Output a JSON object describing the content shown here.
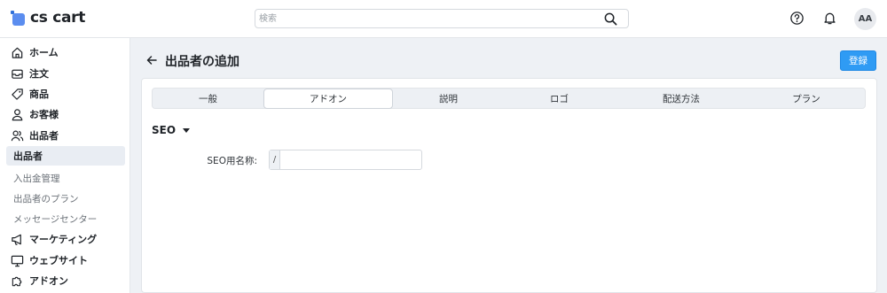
{
  "app": {
    "logo_text": "cs cart",
    "brand_color": "#5b8def"
  },
  "header": {
    "search_placeholder": "検索",
    "search_value": "",
    "avatar_initials": "AA",
    "icons": [
      "search-icon",
      "help-icon",
      "bell-icon"
    ]
  },
  "sidebar": {
    "items": [
      {
        "label": "ホーム",
        "icon": "home-icon"
      },
      {
        "label": "注文",
        "icon": "inbox-icon"
      },
      {
        "label": "商品",
        "icon": "tag-icon"
      },
      {
        "label": "お客様",
        "icon": "user-icon"
      },
      {
        "label": "出品者",
        "icon": "users-icon"
      }
    ],
    "active_label": "出品者",
    "sub_items": [
      "入出金管理",
      "出品者のプラン",
      "メッセージセンター"
    ],
    "bottom_items": [
      {
        "label": "マーケティング",
        "icon": "megaphone-icon"
      },
      {
        "label": "ウェブサイト",
        "icon": "monitor-icon"
      },
      {
        "label": "アドオン",
        "icon": "puzzle-icon"
      }
    ]
  },
  "page": {
    "title": "出品者の追加",
    "register_button": "登録",
    "accent_color": "#2f9bf4"
  },
  "tabs": [
    {
      "label": "一般",
      "active": false
    },
    {
      "label": "アドオン",
      "active": true
    },
    {
      "label": "説明",
      "active": false
    },
    {
      "label": "ロゴ",
      "active": false
    },
    {
      "label": "配送方法",
      "active": false
    },
    {
      "label": "プラン",
      "active": false
    }
  ],
  "seo": {
    "section_title": "SEO",
    "field_label": "SEO用名称:",
    "prefix": "/",
    "value": ""
  }
}
